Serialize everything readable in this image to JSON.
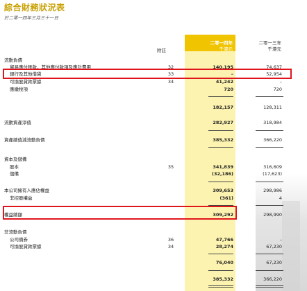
{
  "header": {
    "title": "綜合財務狀況表",
    "subtitle": "於二零一四年三月三十一日",
    "note_col": "附註",
    "current_year": "二零一四年",
    "current_unit": "千港元",
    "prior_year": "二零一三年",
    "prior_unit": "千港元"
  },
  "rows": [
    {
      "label": "流動負債",
      "note": "",
      "cur": "",
      "prev": ""
    },
    {
      "label": "貿易應付賬款，其他應付款項及應計費用",
      "note": "32",
      "cur": "140,195",
      "prev": "74,637"
    },
    {
      "label": "銀行及其他借貸",
      "note": "33",
      "cur": "–",
      "prev": "52,954"
    },
    {
      "label": "可換股貸款票據",
      "note": "34",
      "cur": "41,242",
      "prev": "–"
    },
    {
      "label": "應繳稅項",
      "note": "",
      "cur": "720",
      "prev": "720"
    },
    {
      "label": "",
      "note": "",
      "cur": "182,157",
      "prev": "128,311"
    },
    {
      "label": "流動資產淨值",
      "note": "",
      "cur": "282,927",
      "prev": "318,984"
    },
    {
      "label": "資產總值減流動負債",
      "note": "",
      "cur": "385,332",
      "prev": "366,220"
    },
    {
      "label": "資本及儲備",
      "note": "",
      "cur": "",
      "prev": ""
    },
    {
      "label": "股本",
      "note": "35",
      "cur": "341,839",
      "prev": "316,609"
    },
    {
      "label": "儲備",
      "note": "",
      "cur": "(32,186)",
      "prev": "(17,623)"
    },
    {
      "label": "本公司擁有人應佔權益",
      "note": "",
      "cur": "309,653",
      "prev": "298,986"
    },
    {
      "label": "非控股權益",
      "note": "",
      "cur": "(361)",
      "prev": "4"
    },
    {
      "label": "權益總額",
      "note": "",
      "cur": "309,292",
      "prev": "298,990"
    },
    {
      "label": "非流動負債",
      "note": "",
      "cur": "",
      "prev": ""
    },
    {
      "label": "公司債券",
      "note": "36",
      "cur": "47,766",
      "prev": "–"
    },
    {
      "label": "可換股貸款票據",
      "note": "34",
      "cur": "28,274",
      "prev": "67,230"
    },
    {
      "label": "",
      "note": "",
      "cur": "76,040",
      "prev": "67,230"
    },
    {
      "label": "",
      "note": "",
      "cur": "385,332",
      "prev": "366,220"
    }
  ]
}
